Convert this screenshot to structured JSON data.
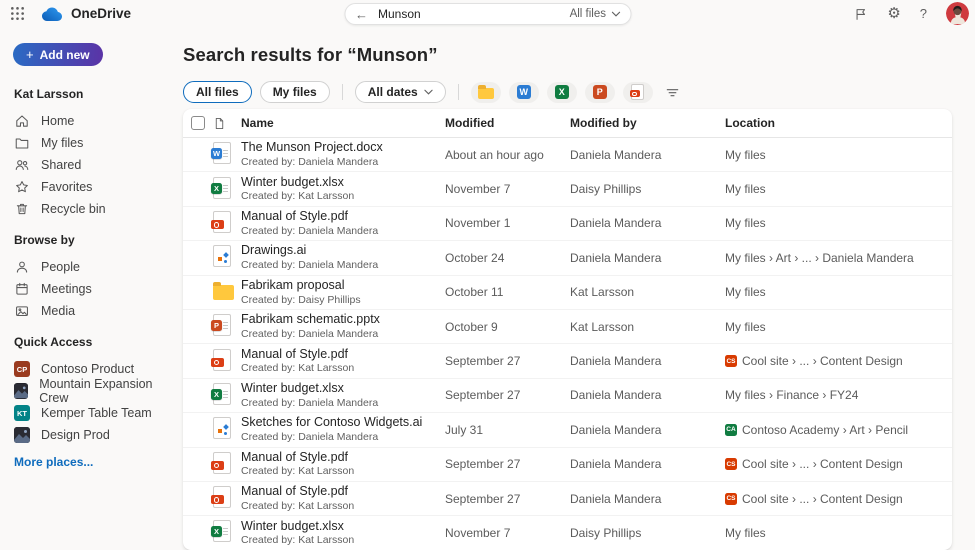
{
  "icons": {
    "back_arrow": "←",
    "settings": "⚙",
    "help": "?",
    "add_plus": "+"
  },
  "topbar": {
    "app_name": "OneDrive",
    "search": {
      "query": "Munson",
      "scope_label": "All files"
    }
  },
  "sidebar": {
    "add_new_label": "Add new",
    "user_name": "Kat Larsson",
    "nav_items": [
      {
        "label": "Home",
        "icon": "home-icon"
      },
      {
        "label": "My files",
        "icon": "folder-icon"
      },
      {
        "label": "Shared",
        "icon": "people-icon"
      },
      {
        "label": "Favorites",
        "icon": "star-icon"
      },
      {
        "label": "Recycle bin",
        "icon": "trash-icon"
      }
    ],
    "browse_by": {
      "title": "Browse by",
      "items": [
        {
          "label": "People",
          "icon": "person-icon"
        },
        {
          "label": "Meetings",
          "icon": "calendar-icon"
        },
        {
          "label": "Media",
          "icon": "media-icon"
        }
      ]
    },
    "quick_access": {
      "title": "Quick Access",
      "items": [
        {
          "label": "Contoso Product",
          "tile": "initials",
          "initials": "CP",
          "color": "#9a3b1f"
        },
        {
          "label": "Mountain Expansion Crew",
          "tile": "photo"
        },
        {
          "label": "Kemper Table Team",
          "tile": "initials",
          "initials": "KT",
          "color": "#038387"
        },
        {
          "label": "Design Prod",
          "tile": "photo"
        }
      ],
      "more_label": "More places..."
    }
  },
  "main": {
    "title": "Search results for “Munson”",
    "filters": {
      "scope_pills": [
        {
          "label": "All files",
          "selected": true
        },
        {
          "label": "My files",
          "selected": false
        }
      ],
      "date_pill_label": "All dates",
      "type_chips": [
        {
          "name": "folder-filter",
          "type": "folder"
        },
        {
          "name": "word-filter",
          "type": "word"
        },
        {
          "name": "excel-filter",
          "type": "excel"
        },
        {
          "name": "powerpoint-filter",
          "type": "powerpoint"
        },
        {
          "name": "pdf-filter",
          "type": "pdf"
        }
      ]
    },
    "table": {
      "columns": [
        "Name",
        "Modified",
        "Modified by",
        "Location"
      ],
      "rows": [
        {
          "type": "word",
          "name": "The Munson Project.docx",
          "created_by": "Created by: Daniela Mandera",
          "modified": "About an hour ago",
          "modified_by": "Daniela Mandera",
          "location": {
            "text": "My files"
          }
        },
        {
          "type": "excel",
          "name": "Winter budget.xlsx",
          "created_by": "Created by: Kat Larsson",
          "modified": "November 7",
          "modified_by": "Daisy Phillips",
          "location": {
            "text": "My files"
          }
        },
        {
          "type": "pdf",
          "name": "Manual of Style.pdf",
          "created_by": "Created by: Daniela Mandera",
          "modified": "November 1",
          "modified_by": "Daniela Mandera",
          "location": {
            "text": "My files"
          }
        },
        {
          "type": "ai",
          "name": "Drawings.ai",
          "created_by": "Created by: Daniela Mandera",
          "modified": "October 24",
          "modified_by": "Daniela Mandera",
          "location": {
            "text": "My files › Art › ... › Daniela Mandera"
          }
        },
        {
          "type": "folder",
          "name": "Fabrikam proposal",
          "created_by": "Created by: Daisy Phillips",
          "modified": "October 11",
          "modified_by": "Kat Larsson",
          "location": {
            "text": "My files"
          }
        },
        {
          "type": "powerpoint",
          "name": "Fabrikam schematic.pptx",
          "created_by": "Created by: Daniela Mandera",
          "modified": "October 9",
          "modified_by": "Kat Larsson",
          "location": {
            "text": "My files"
          }
        },
        {
          "type": "pdf",
          "name": "Manual of Style.pdf",
          "created_by": "Created by: Kat Larsson",
          "modified": "September 27",
          "modified_by": "Daniela Mandera",
          "location": {
            "badge": {
              "text": "CS",
              "color": "#d83b01"
            },
            "text": "Cool site › ... › Content Design"
          }
        },
        {
          "type": "excel",
          "name": "Winter budget.xlsx",
          "created_by": "Created by: Daniela Mandera",
          "modified": "September 27",
          "modified_by": "Daniela Mandera",
          "location": {
            "text": "My files › Finance › FY24"
          }
        },
        {
          "type": "ai",
          "name": "Sketches for Contoso Widgets.ai",
          "created_by": "Created by: Daniela Mandera",
          "modified": "July 31",
          "modified_by": "Daniela Mandera",
          "location": {
            "badge": {
              "text": "CA",
              "color": "#107c41"
            },
            "text": "Contoso Academy › Art › Pencil"
          }
        },
        {
          "type": "pdf",
          "name": "Manual of Style.pdf",
          "created_by": "Created by: Kat Larsson",
          "modified": "September 27",
          "modified_by": "Daniela Mandera",
          "location": {
            "badge": {
              "text": "CS",
              "color": "#d83b01"
            },
            "text": "Cool site › ... › Content Design"
          }
        },
        {
          "type": "pdf",
          "name": "Manual of Style.pdf",
          "created_by": "Created by: Kat Larsson",
          "modified": "September 27",
          "modified_by": "Daniela Mandera",
          "location": {
            "badge": {
              "text": "CS",
              "color": "#d83b01"
            },
            "text": "Cool site › ... › Content Design"
          }
        },
        {
          "type": "excel",
          "name": "Winter budget.xlsx",
          "created_by": "Created by: Kat Larsson",
          "modified": "November 7",
          "modified_by": "Daisy Phillips",
          "location": {
            "text": "My files"
          }
        }
      ]
    }
  },
  "colors": {
    "accent": "#0f6cbd",
    "word": "#2b7cd3",
    "excel": "#107c41",
    "powerpoint": "#cb4a20",
    "pdf": "#dc3e15",
    "folder": "#ffc83d"
  }
}
